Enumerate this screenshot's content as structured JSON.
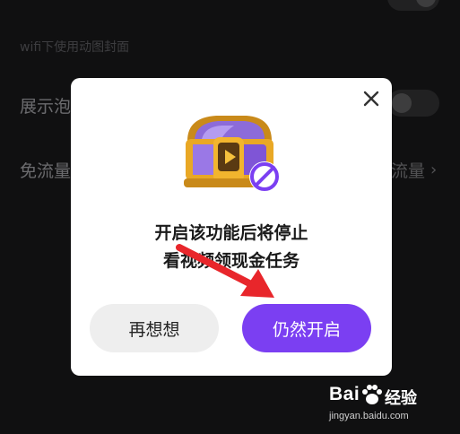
{
  "background": {
    "caption": "wifi下使用动图封面",
    "row1_label": "展示泡",
    "row2_label": "免流量",
    "row2_right": "流量",
    "chevron": "›"
  },
  "dialog": {
    "message_line1": "开启该功能后将停止",
    "message_line2": "看视频领现金任务",
    "cancel_label": "再想想",
    "confirm_label": "仍然开启"
  },
  "colors": {
    "accent": "#7b3ff2",
    "cancel_bg": "#eeeeee",
    "arrow": "#e8262b"
  },
  "watermark": {
    "logo_left": "Bai",
    "logo_right": "经验",
    "url": "jingyan.baidu.com"
  }
}
